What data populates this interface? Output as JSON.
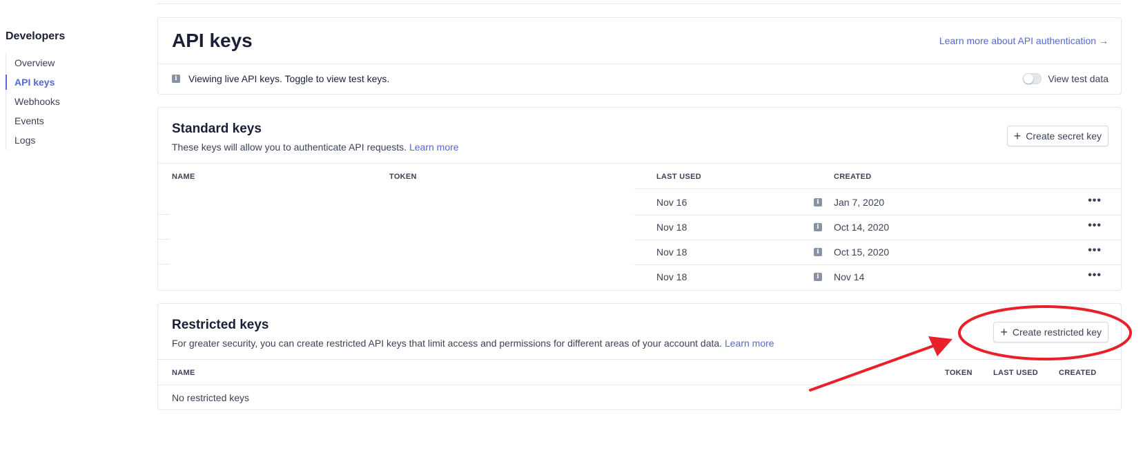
{
  "sidebar": {
    "title": "Developers",
    "items": [
      {
        "label": "Overview",
        "active": false
      },
      {
        "label": "API keys",
        "active": true
      },
      {
        "label": "Webhooks",
        "active": false
      },
      {
        "label": "Events",
        "active": false
      },
      {
        "label": "Logs",
        "active": false
      }
    ]
  },
  "header": {
    "title": "API keys",
    "learn_link": "Learn more about API authentication →",
    "notice": "Viewing live API keys. Toggle to view test keys.",
    "toggle_label": "View test data",
    "toggle_on": false
  },
  "standard": {
    "title": "Standard keys",
    "desc": "These keys will allow you to authenticate API requests.",
    "learn_more": "Learn more",
    "create_button": "Create secret key",
    "columns": {
      "name": "NAME",
      "token": "TOKEN",
      "last_used": "LAST USED",
      "created": "CREATED"
    },
    "rows": [
      {
        "last_used": "Nov 16",
        "created": "Jan 7, 2020"
      },
      {
        "last_used": "Nov 18",
        "created": "Oct 14, 2020"
      },
      {
        "last_used": "Nov 18",
        "created": "Oct 15, 2020"
      },
      {
        "last_used": "Nov 18",
        "created": "Nov 14"
      }
    ],
    "row_menu": "•••"
  },
  "restricted": {
    "title": "Restricted keys",
    "desc": "For greater security, you can create restricted API keys that limit access and permissions for different areas of your account data.",
    "learn_more": "Learn more",
    "create_button": "Create restricted key",
    "columns": {
      "name": "NAME",
      "token": "TOKEN",
      "last_used": "LAST USED",
      "created": "CREATED"
    },
    "empty": "No restricted keys"
  },
  "icons": {
    "info": "info-icon",
    "plus": "plus-icon",
    "more": "more-horizontal-icon"
  },
  "colors": {
    "accent": "#5469d4",
    "annotation": "#e8202a"
  }
}
